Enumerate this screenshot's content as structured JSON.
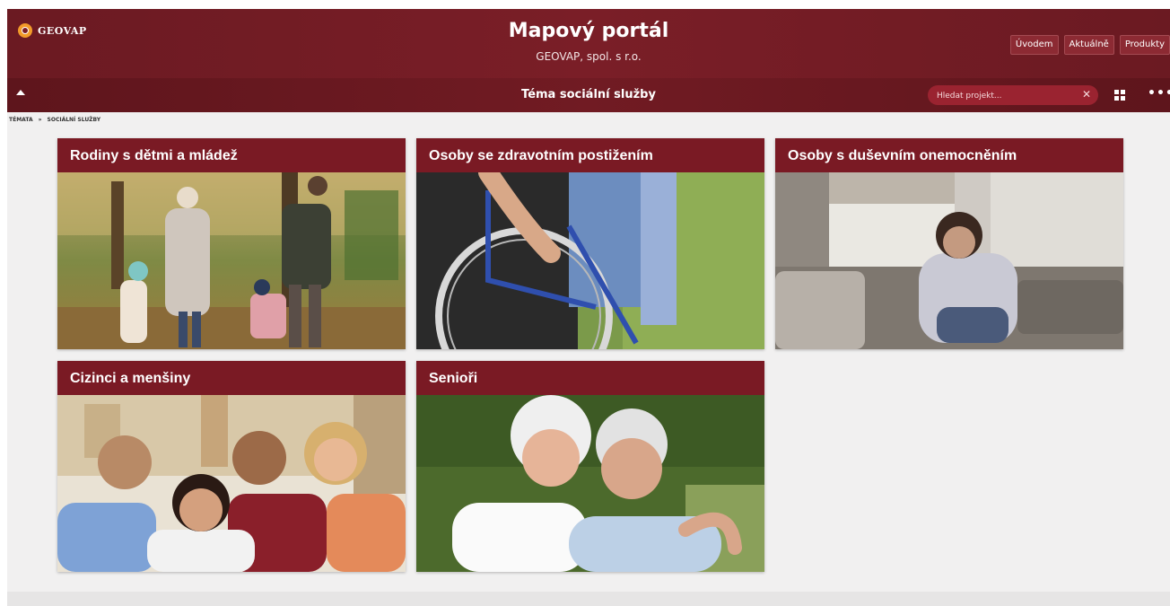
{
  "header": {
    "logo_text": "GEOVAP",
    "title": "Mapový portál",
    "subtitle": "GEOVAP, spol. s r.o.",
    "nav": [
      "Úvodem",
      "Aktuálně",
      "Produkty"
    ]
  },
  "subbar": {
    "theme_title": "Téma sociální služby",
    "search_placeholder": "Hledat projekt...",
    "clear_glyph": "✕",
    "more_glyph": "•••"
  },
  "breadcrumb": {
    "items": [
      "TÉMATA",
      "»",
      "SOCIÁLNÍ SLUŽBY"
    ]
  },
  "cards": [
    {
      "title": "Rodiny s dětmi a mládež",
      "image": "family-walking-park-photo"
    },
    {
      "title": "Osoby se zdravotním postižením",
      "image": "wheelchair-photo"
    },
    {
      "title": "Osoby s duševním onemocněním",
      "image": "sad-woman-sofa-photo"
    },
    {
      "title": "Cizinci a menšiny",
      "image": "diverse-group-photo"
    },
    {
      "title": "Senioři",
      "image": "senior-couple-photo"
    }
  ],
  "colors": {
    "brand": "#7a1e27",
    "card_header": "#7a1a24",
    "search_bg": "#9a2330",
    "logo_accent": "#f29b2a"
  }
}
